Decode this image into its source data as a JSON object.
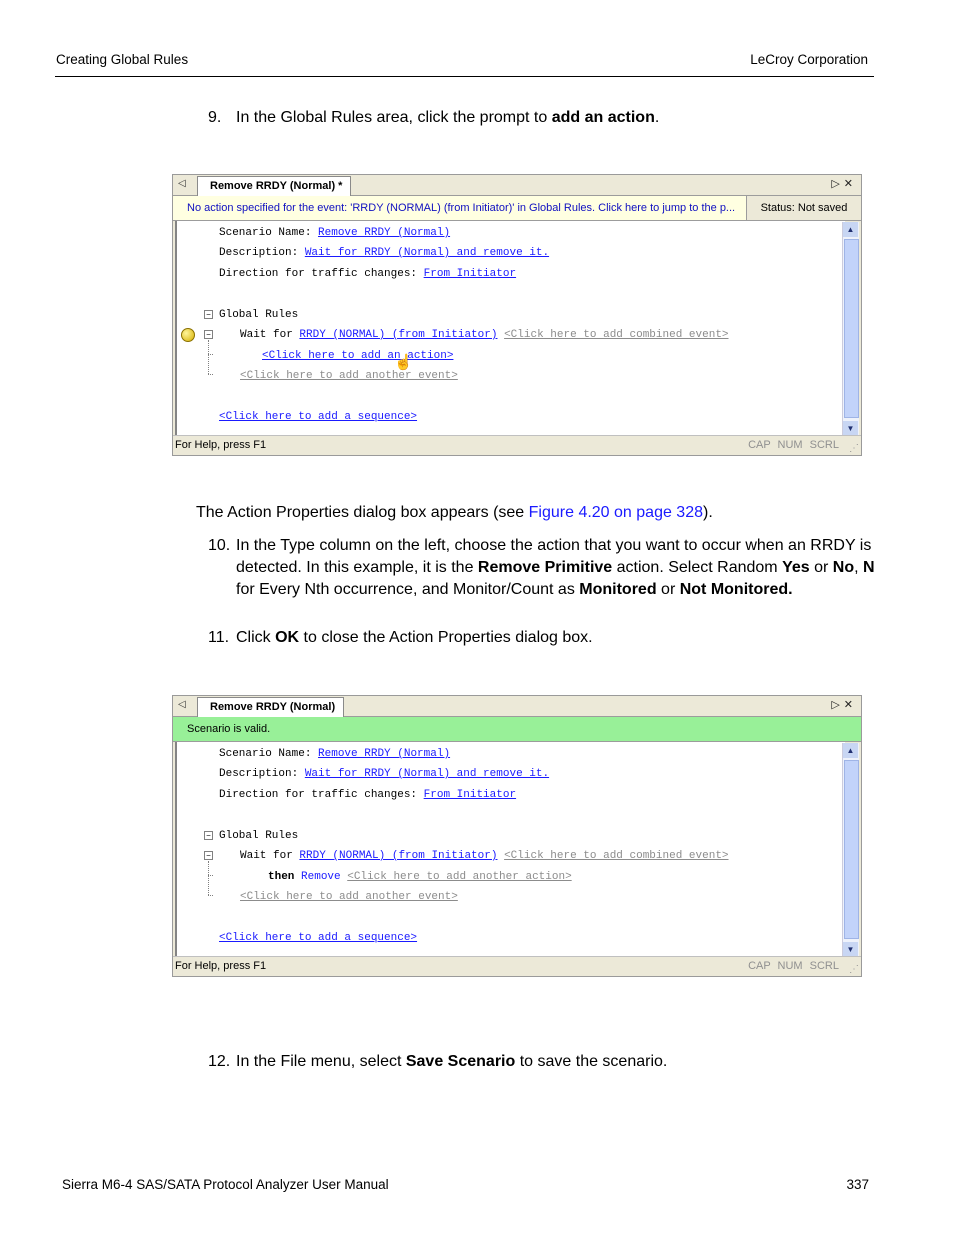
{
  "header": {
    "left": "Creating Global Rules",
    "right": "LeCroy Corporation"
  },
  "footer": {
    "left": "Sierra M6-4 SAS/SATA Protocol Analyzer User Manual",
    "right": "337"
  },
  "step9": {
    "num": "9.",
    "pre": "In the Global Rules area, click the prompt to ",
    "bold": "add an action",
    "post": "."
  },
  "para1": {
    "pre": "The Action Properties dialog box appears (see ",
    "link": "Figure 4.20 on page 328",
    "post": ")."
  },
  "step10": {
    "num": "10.",
    "t1": "In the Type column on the left, choose the action that you want to occur when an RRDY is detected. In this example, it is the ",
    "b1": "Remove Primitive",
    "t2": " action. Select Random ",
    "b2": "Yes",
    "t3": " or ",
    "b3": "No",
    "t4": ", ",
    "b4": "N",
    "t5": " for Every Nth occurrence, and Monitor/Count as ",
    "b5": "Monitored",
    "t6": " or ",
    "b6": "Not Monitored."
  },
  "step11": {
    "num": "11.",
    "pre": "Click ",
    "bold": "OK",
    "post": " to close the Action Properties dialog box."
  },
  "step12": {
    "num": "12.",
    "pre": "In the File menu, select ",
    "bold": "Save Scenario",
    "post": " to save the scenario."
  },
  "window1": {
    "tab": "Remove RRDY (Normal) *",
    "message": "No action specified for the event: 'RRDY (NORMAL) (from Initiator)' in Global Rules.  Click here to jump to the p...",
    "status": "Status: Not saved",
    "scenario_label": "Scenario Name: ",
    "scenario_value": "Remove RRDY (Normal)",
    "description_label": "Description: ",
    "description_value": "Wait for RRDY (Normal) and remove it.",
    "direction_label": "Direction for traffic changes: ",
    "direction_value": "From Initiator",
    "global_rules": "Global Rules",
    "wait_for": "Wait for ",
    "event": "RRDY (NORMAL) (from Initiator)",
    "add_combined": "<Click here to add combined event>",
    "add_action": "<Click here to add an action>",
    "add_event": "<Click here to add another event>",
    "add_sequence": "<Click here to add a sequence>",
    "help": "For Help, press F1",
    "indicators": "CAP NUM SCRL"
  },
  "window2": {
    "tab": "Remove RRDY (Normal)",
    "message": "Scenario is valid.",
    "scenario_label": "Scenario Name: ",
    "scenario_value": "Remove RRDY (Normal)",
    "description_label": "Description: ",
    "description_value": "Wait for RRDY (Normal) and remove it.",
    "direction_label": "Direction for traffic changes: ",
    "direction_value": "From Initiator",
    "global_rules": "Global Rules",
    "wait_for": "Wait for ",
    "event": "RRDY (NORMAL) (from Initiator)",
    "add_combined": "<Click here to add combined event>",
    "then": "then ",
    "action": "Remove",
    "add_another_action": "<Click here to add another action>",
    "add_event": "<Click here to add another event>",
    "add_sequence": "<Click here to add a sequence>",
    "help": "For Help, press F1",
    "indicators": "CAP NUM SCRL"
  },
  "icons": {
    "tab_left": "triangle-left-icon",
    "tab_menu": "triangle-right-icon",
    "close": "close-icon",
    "warning_bullet": "yellow-circle-icon",
    "cursor": "hand-cursor-icon"
  }
}
